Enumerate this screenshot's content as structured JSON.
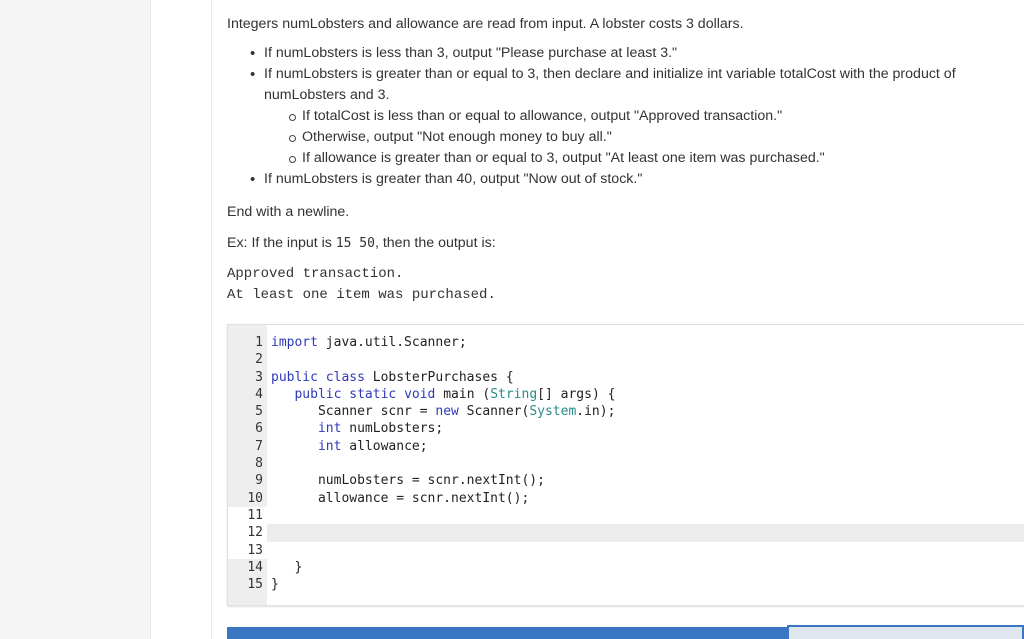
{
  "prompt": {
    "intro": "Integers numLobsters and allowance are read from input. A lobster costs 3 dollars.",
    "bullets": [
      "If numLobsters is less than 3, output \"Please purchase at least 3.\"",
      "If numLobsters is greater than or equal to 3, then declare and initialize int variable totalCost with the product of numLobsters and 3.",
      "If numLobsters is greater than 40, output \"Now out of stock.\""
    ],
    "sub_bullets": [
      "If totalCost is less than or equal to allowance, output \"Approved transaction.\"",
      "Otherwise, output \"Not enough money to buy all.\"",
      "If allowance is greater than or equal to 3, output \"At least one item was purchased.\""
    ],
    "end_note": "End with a newline.",
    "example_prefix": "Ex: If the input is ",
    "example_input": "15 50",
    "example_suffix": ", then the output is:",
    "example_output": [
      "Approved transaction.",
      "At least one item was purchased."
    ]
  },
  "editor": {
    "lines": [
      {
        "n": "1",
        "text": "import java.util.Scanner;"
      },
      {
        "n": "2",
        "text": ""
      },
      {
        "n": "3",
        "text": "public class LobsterPurchases {"
      },
      {
        "n": "4",
        "text": "   public static void main (String[] args) {"
      },
      {
        "n": "5",
        "text": "      Scanner scnr = new Scanner(System.in);"
      },
      {
        "n": "6",
        "text": "      int numLobsters;"
      },
      {
        "n": "7",
        "text": "      int allowance;"
      },
      {
        "n": "8",
        "text": ""
      },
      {
        "n": "9",
        "text": "      numLobsters = scnr.nextInt();"
      },
      {
        "n": "10",
        "text": "      allowance = scnr.nextInt();"
      },
      {
        "n": "11",
        "text": ""
      },
      {
        "n": "12",
        "text": ""
      },
      {
        "n": "13",
        "text": ""
      },
      {
        "n": "14",
        "text": "   }"
      },
      {
        "n": "15",
        "text": "}"
      }
    ]
  },
  "colors": {
    "keyword": "#2f3ab8",
    "type": "#2a8a8a",
    "accent": "#3a77c2"
  }
}
